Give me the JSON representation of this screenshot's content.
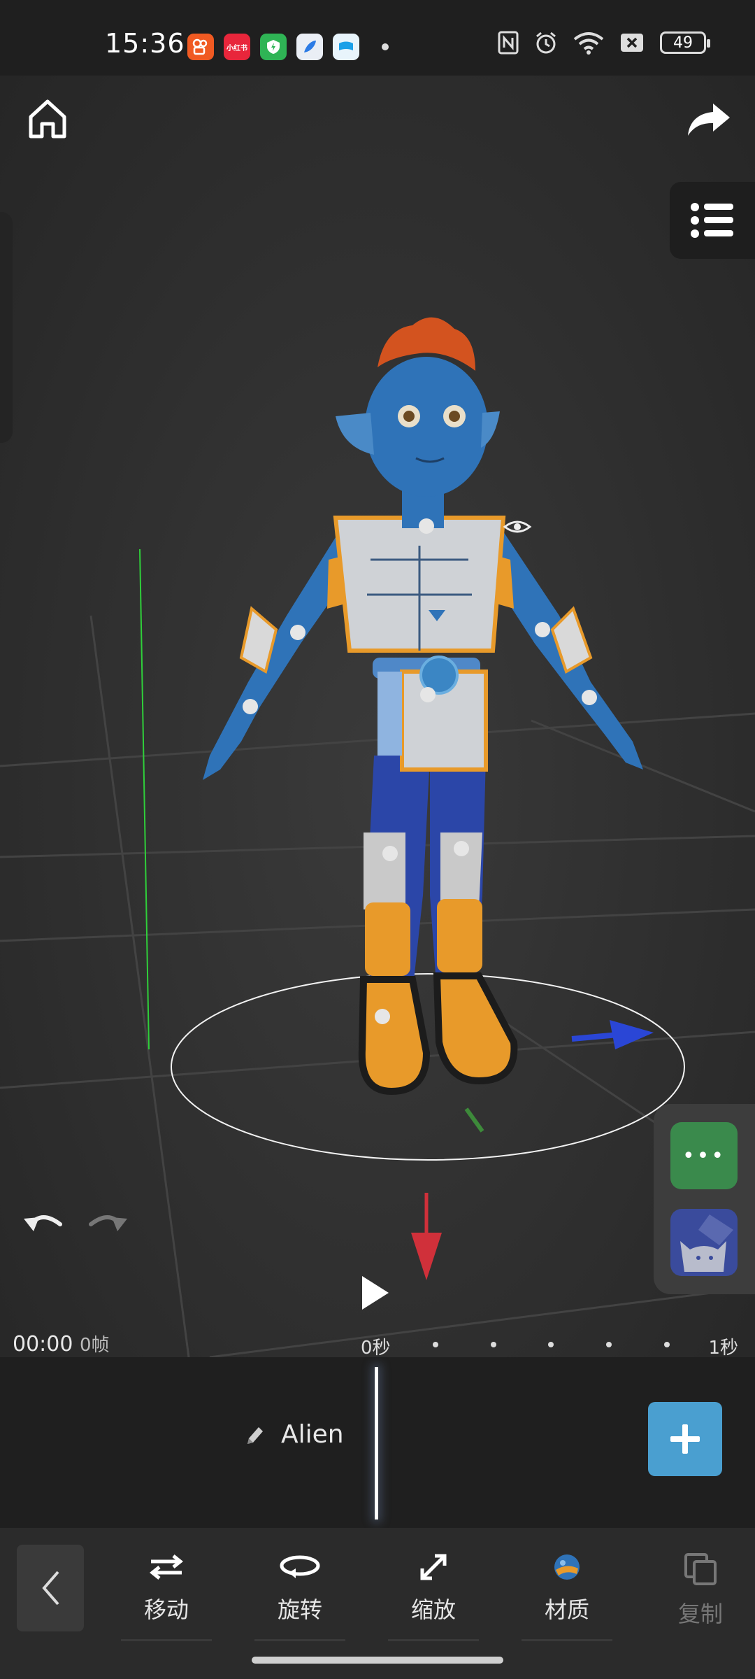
{
  "status_bar": {
    "time": "15:36",
    "apps": [
      {
        "icon": "kuaishou-app-icon",
        "color": "#f05a22",
        "text": ""
      },
      {
        "icon": "xiaohongshu-app-icon",
        "color": "#e8263b",
        "text": "小红书"
      },
      {
        "icon": "security-app-icon",
        "color": "#2fb455",
        "text": ""
      },
      {
        "icon": "browser-app-icon",
        "color": "#2c7be5",
        "text": ""
      },
      {
        "icon": "flag-app-icon",
        "color": "#1aa0e8",
        "text": ""
      }
    ],
    "battery": "49"
  },
  "viewport": {
    "character_name": "Alien",
    "colors": {
      "x_axis": "#2a46d6",
      "y_axis": "#2fcf3a",
      "z_axis": "#d0303a",
      "skin": "#2f73b8",
      "hair": "#d3531f",
      "armor_orange": "#e89a2a"
    }
  },
  "playback": {
    "timecode": "00:00",
    "frame_label": "0帧",
    "start_label": "0秒",
    "end_label": "1秒"
  },
  "timeline": {
    "track_name": "Alien"
  },
  "toolbar": {
    "items": [
      {
        "label": "移动",
        "icon": "move-arrows-icon"
      },
      {
        "label": "旋转",
        "icon": "rotate-icon"
      },
      {
        "label": "缩放",
        "icon": "scale-icon"
      },
      {
        "label": "材质",
        "icon": "material-sphere-icon"
      },
      {
        "label": "复制",
        "icon": "copy-icon"
      }
    ]
  }
}
